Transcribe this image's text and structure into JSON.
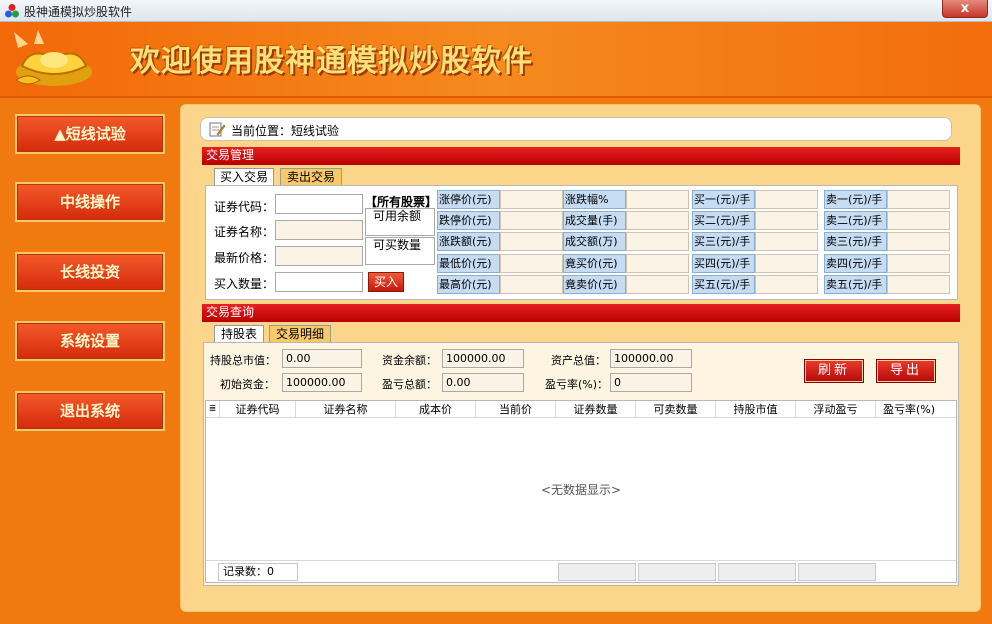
{
  "window": {
    "title": "股神通模拟炒股软件",
    "close_label": "x"
  },
  "header": {
    "title": "欢迎使用股神通模拟炒股软件"
  },
  "sidebar": {
    "items": [
      {
        "label": "▲短线试验"
      },
      {
        "label": "中线操作"
      },
      {
        "label": "长线投资"
      },
      {
        "label": "系统设置"
      },
      {
        "label": "退出系统"
      }
    ]
  },
  "breadcrumb": {
    "label": "当前位置：",
    "value": "短线试验"
  },
  "trade": {
    "section_title": "交易管理",
    "tabs": [
      "买入交易",
      "卖出交易"
    ],
    "fields": [
      {
        "label": "证券代码：",
        "value": ""
      },
      {
        "label": "证券名称：",
        "value": ""
      },
      {
        "label": "最新价格：",
        "value": ""
      },
      {
        "label": "买入数量：",
        "value": ""
      }
    ],
    "all_stocks_label": "【所有股票】",
    "available_balance_label": "可用余额",
    "available_qty_label": "可买数量",
    "buy_button": "买入",
    "quote_labels": [
      [
        "涨停价(元)",
        "涨跌幅%",
        "买一(元)/手",
        "卖一(元)/手"
      ],
      [
        "跌停价(元)",
        "成交量(手)",
        "买二(元)/手",
        "卖二(元)/手"
      ],
      [
        "涨跌额(元)",
        "成交额(万)",
        "买三(元)/手",
        "卖三(元)/手"
      ],
      [
        "最低价(元)",
        "竟买价(元)",
        "买四(元)/手",
        "卖四(元)/手"
      ],
      [
        "最高价(元)",
        "竟卖价(元)",
        "买五(元)/手",
        "卖五(元)/手"
      ]
    ]
  },
  "query": {
    "section_title": "交易查询",
    "tabs": [
      "持股表",
      "交易明细"
    ],
    "summary": [
      {
        "label": "持股总市值：",
        "value": "0.00"
      },
      {
        "label": "资金余额：",
        "value": "100000.00"
      },
      {
        "label": "资产总值：",
        "value": "100000.00"
      },
      {
        "label": "初始资金：",
        "value": "100000.00"
      },
      {
        "label": "盈亏总额：",
        "value": "0.00"
      },
      {
        "label": "盈亏率(%)：",
        "value": "0"
      }
    ],
    "refresh_button": "刷新",
    "export_button": "导出",
    "columns": [
      "证券代码",
      "证券名称",
      "成本价",
      "当前价",
      "证券数量",
      "可卖数量",
      "持股市值",
      "浮动盈亏",
      "盈亏率(%)"
    ],
    "empty_text": "<无数据显示>",
    "record_count_label": "记录数：",
    "record_count": "0"
  },
  "colors": {
    "accent": "#d42a0c",
    "background": "#f07a10",
    "section_bar": "#e01818",
    "panel": "#fbd58a"
  }
}
